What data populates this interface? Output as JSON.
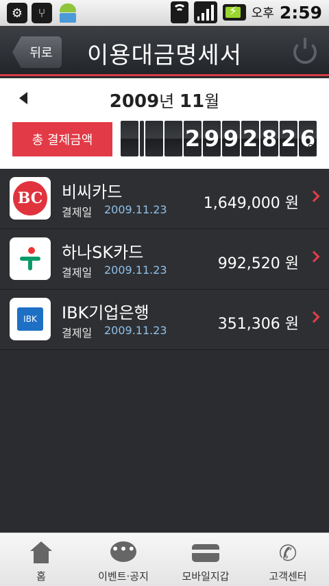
{
  "status_bar": {
    "ampm": "오후",
    "time": "2:59",
    "icons": [
      "android-debug-icon",
      "usb-icon",
      "android-icon",
      "wifi-icon",
      "signal-icon",
      "battery-charging-icon"
    ]
  },
  "header": {
    "back_label": "뒤로",
    "title": "이용대금명세서",
    "power_icon": "power-icon"
  },
  "summary": {
    "year": "2009",
    "year_unit": "년",
    "month": "11",
    "month_unit": "월",
    "total_label": "총 결제금액",
    "total_digits": [
      "",
      "",
      "",
      "2",
      "9",
      "9",
      "2",
      "8",
      "2",
      "6"
    ],
    "currency": "원"
  },
  "cards": [
    {
      "name": "비씨카드",
      "pay_label": "결제일",
      "pay_date": "2009.11.23",
      "amount": "1,649,000 원",
      "logo": "bc-card-logo"
    },
    {
      "name": "하나SK카드",
      "pay_label": "결제일",
      "pay_date": "2009.11.23",
      "amount": "992,520 원",
      "logo": "hana-sk-logo"
    },
    {
      "name": "IBK기업은행",
      "pay_label": "결제일",
      "pay_date": "2009.11.23",
      "amount": "351,306 원",
      "logo": "ibk-logo"
    }
  ],
  "logos": {
    "bc_text": "BC",
    "ibk_text": "IBK"
  },
  "tabs": [
    {
      "label": "홈",
      "icon": "home-icon"
    },
    {
      "label": "이벤트·공지",
      "icon": "chat-bubble-icon"
    },
    {
      "label": "모바일지갑",
      "icon": "wallet-card-icon"
    },
    {
      "label": "고객센터",
      "icon": "phone-icon"
    }
  ],
  "colors": {
    "accent": "#e23a46",
    "date": "#8ec0ea",
    "list_bg": "#2e2f32"
  }
}
